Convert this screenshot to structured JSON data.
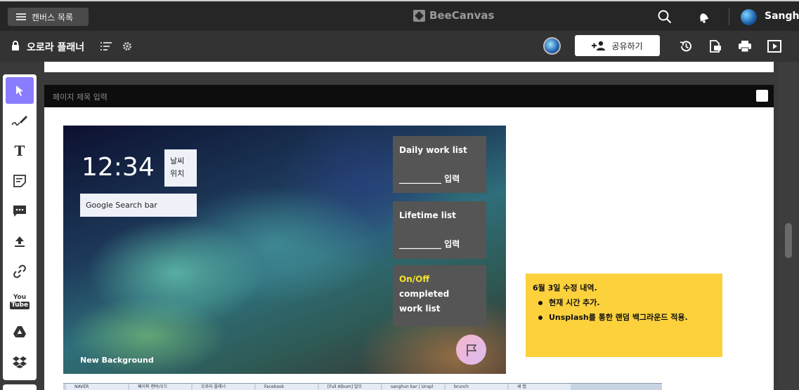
{
  "topbar": {
    "canvas_list_label": "캔버스 목록",
    "brand": "BeeCanvas",
    "username": "Sanghu"
  },
  "subbar": {
    "canvas_title": "오로라 플래너",
    "share_label": "공유하기"
  },
  "page": {
    "title_placeholder": "페이지 제목 입력"
  },
  "wallpaper": {
    "clock": "12:34",
    "weather_line1": "날씨",
    "weather_line2": "위치",
    "search_bar": "Google Search bar",
    "new_background": "New Background",
    "cards": {
      "daily_title": "Daily work list",
      "daily_fill": "__________ 입력",
      "lifetime_title": "Lifetime list",
      "lifetime_fill": "__________ 입력",
      "onoff_highlight": "On/Off",
      "onoff_rest": " completed",
      "onoff_line2": "work list"
    }
  },
  "sticky": {
    "heading": "6월 3일 수정 내역.",
    "items": [
      "현재 시간 추가.",
      "Unsplash를 통한 랜덤 백그라운드 적용."
    ]
  },
  "browser_tabs": [
    "NAVER",
    "페이퍼 캔버/우드",
    "오로라 플래너",
    "Facebook",
    "[Full Album] 알오",
    "sanghun bar | Unspl",
    "brunch",
    "새 탭"
  ],
  "colors": {
    "accent": "#8a7cff",
    "sticky": "#fcd13c",
    "highlight": "#f7e32c"
  }
}
